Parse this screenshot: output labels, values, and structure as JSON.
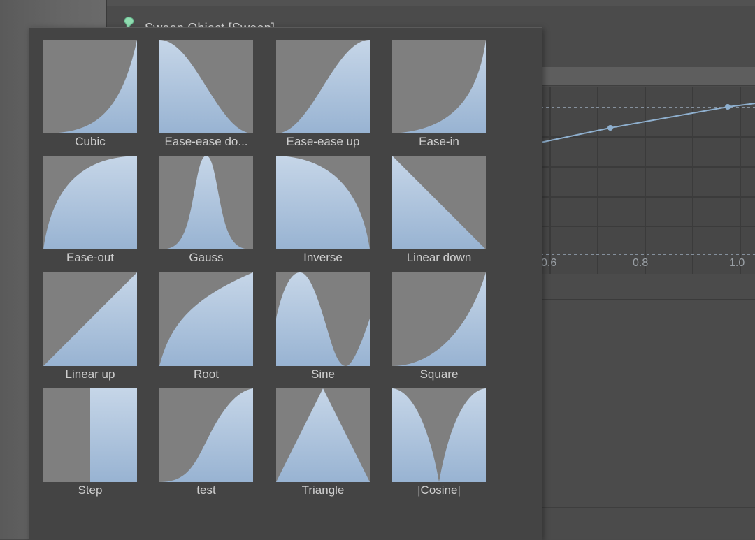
{
  "window": {
    "object_title": "Sweep Object [Sweep]"
  },
  "graph": {
    "tick_labels": [
      "0.6",
      "0.8",
      "1.0"
    ],
    "line_color": "#8fb0cf"
  },
  "colors": {
    "fill_top": "#c6d6e8",
    "fill_bottom": "#98b3d2",
    "thumb_bg": "#7f7f7f",
    "accent_icon": "#8fdcb0"
  },
  "presets": [
    {
      "label": "Cubic",
      "curve": "cubic"
    },
    {
      "label": "Ease-ease do...",
      "curve": "ease-ease-down"
    },
    {
      "label": "Ease-ease up",
      "curve": "ease-ease-up"
    },
    {
      "label": "Ease-in",
      "curve": "ease-in"
    },
    {
      "label": "Ease-out",
      "curve": "ease-out"
    },
    {
      "label": "Gauss",
      "curve": "gauss"
    },
    {
      "label": "Inverse",
      "curve": "inverse"
    },
    {
      "label": "Linear down",
      "curve": "linear-down"
    },
    {
      "label": "Linear up",
      "curve": "linear-up"
    },
    {
      "label": "Root",
      "curve": "root"
    },
    {
      "label": "Sine",
      "curve": "sine"
    },
    {
      "label": "Square",
      "curve": "square"
    },
    {
      "label": "Step",
      "curve": "step"
    },
    {
      "label": "test",
      "curve": "test"
    },
    {
      "label": "Triangle",
      "curve": "triangle"
    },
    {
      "label": "|Cosine|",
      "curve": "abs-cosine"
    }
  ]
}
